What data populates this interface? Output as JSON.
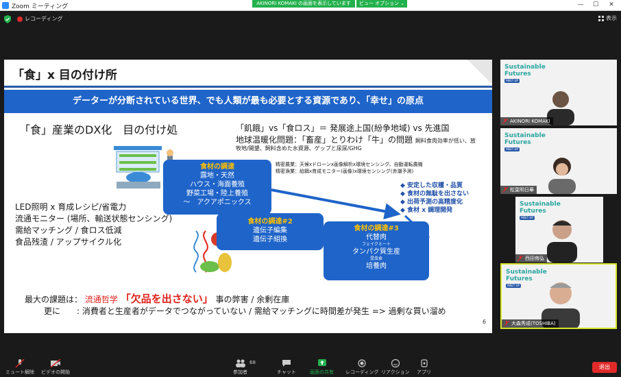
{
  "window": {
    "title": "Zoom ミーティング",
    "share_banner": "AKINORI KOMAKI の画面を表示しています",
    "view_options": "ビュー オプション ⌄",
    "minimize": "—",
    "maximize": "☐",
    "close": "✕"
  },
  "topbar": {
    "recording_label": "レコーディング",
    "view_label": "表示"
  },
  "slide": {
    "title": "「食」x 目の付け所",
    "banner": "データーが分断されている世界、でも人類が最も必要とする資源であり、「幸せ」の原点",
    "heading_left": "「食」産業のDX化　目の付け処",
    "heading_right_1": "「飢餓」vs「食ロス」＝ 発展途上国(紛争地域) vs 先進国",
    "heading_right_2_main": "地球温暖化問題：「畜産」とりわけ「牛」の問題",
    "heading_right_2_small": "飼料食肉効率が低い、放",
    "heading_right_3": "牧地/開墾、飼料含めた水資源、ゲップと尿尿/GHG",
    "box1": {
      "title": "食材の調達",
      "lines": [
        "露地・天然",
        "ハウス・海面養殖",
        "野菜工場・陸上養殖",
        "〜　アクアポニックス"
      ]
    },
    "detail_1": "精密農業：天候xドローンx画像解析x環境センシング、自動運転農機",
    "detail_2": "精密漁業：給餌x育成モニター(画像)x環境センシング(赤潮予測)",
    "benefits": [
      "◆ 安定した収穫・品質",
      "◆ 食材の無駄を出さない",
      "◆ 出荷予測の高精度化",
      "◆ 食材 x 調理開発"
    ],
    "box2": {
      "title": "食材の調達#2",
      "lines": [
        "遺伝子編集",
        "遺伝子組換"
      ]
    },
    "box3": {
      "title": "食材の調達#3",
      "line1": "代替肉",
      "tiny1": "フェイクミート",
      "line2": "タンパク質生産",
      "tiny2": "昆虫食",
      "line3": "培養肉"
    },
    "left_list": [
      "LED照明 x 育成レシピ/省電力",
      "流通モニター (場所、輸送状態センシング)",
      "需給マッチング / 食ロス低減",
      "食品残渣 / アップサイクル化"
    ],
    "issue_prefix": "最大の課題は：",
    "issue_red": "流通哲学",
    "issue_big": "「欠品を出さない」",
    "issue_suffix": "事の弊害 / 余剰在庫",
    "issue_line2": "更に　　: 消費者と生産者がデータでつながっていない / 需給マッチングに時間差が発生 => 過剰な買い溜め",
    "page_number": "6"
  },
  "participants": [
    {
      "name": "AKINORI KOMAKI",
      "sf_line1": "Sustainable",
      "sf_line2": "Futures",
      "sf_tag": "MEET UP"
    },
    {
      "name": "松葉明日華",
      "sf_line1": "Sustainable",
      "sf_line2": "Futures",
      "sf_tag": "MEET UP"
    },
    {
      "name": "西田侑弘",
      "sf_line1": "Sustainable",
      "sf_line2": "Futures",
      "sf_tag": "MEET UP"
    },
    {
      "name": "大森秀成(TOSHIBA)",
      "sf_line1": "Sustainable",
      "sf_line2": "Futures",
      "sf_tag": "MEET UP"
    }
  ],
  "toolbar": {
    "mute": "ミュート解除",
    "video": "ビデオの開始",
    "participants": "参加者",
    "participants_count": "68",
    "chat": "チャット",
    "share": "画面の共有",
    "record": "レコーディング",
    "reactions": "リアクション",
    "apps": "アプリ",
    "leave": "退出"
  },
  "colors": {
    "accent_blue": "#1f64c9",
    "share_green": "#23b14d",
    "highlight_red": "#e0201b",
    "box_title_yellow": "#ffc000",
    "leave_red": "#e02a2a"
  }
}
